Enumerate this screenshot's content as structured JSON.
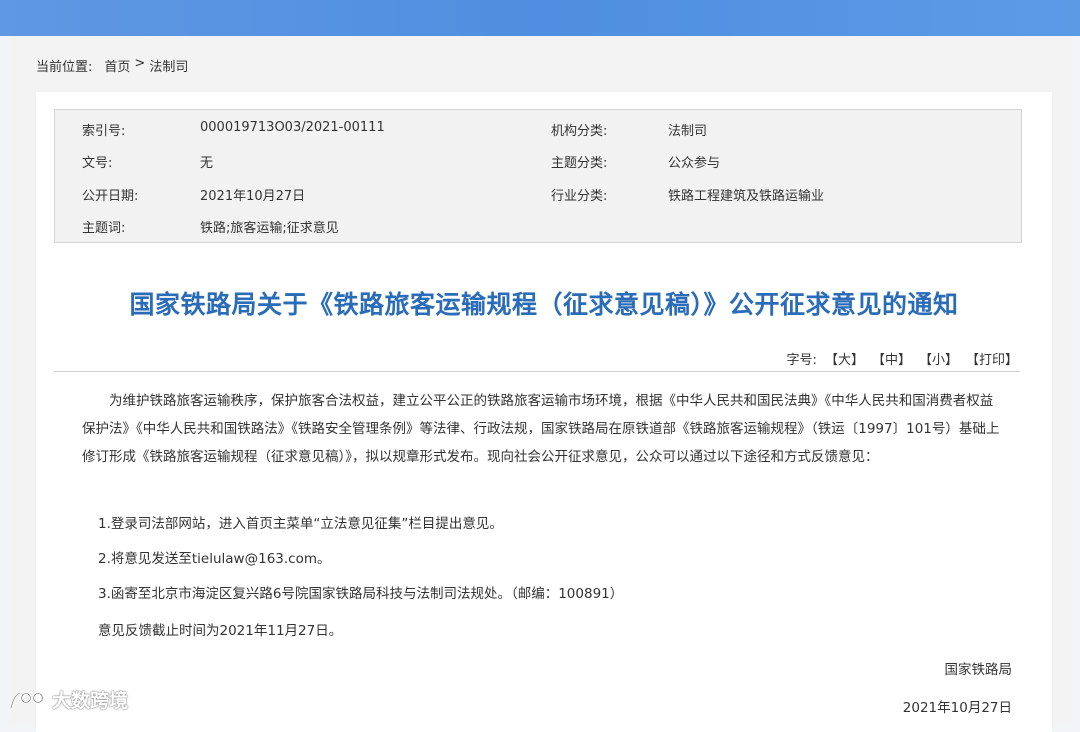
{
  "breadcrumb": {
    "label": "当前位置:",
    "home": "首页",
    "separator": ">",
    "current": "法制司"
  },
  "meta": {
    "index_label": "索引号:",
    "index_value": "000019713O03/2021-00111",
    "org_label": "机构分类:",
    "org_value": "法制司",
    "docno_label": "文号:",
    "docno_value": "无",
    "topic_label": "主题分类:",
    "topic_value": "公众参与",
    "date_label": "公开日期:",
    "date_value": "2021年10月27日",
    "industry_label": "行业分类:",
    "industry_value": "铁路工程建筑及铁路运输业",
    "keywords_label": "主题词:",
    "keywords_value": "铁路;旅客运输;征求意见"
  },
  "article": {
    "title": "国家铁路局关于《铁路旅客运输规程（征求意见稿）》公开征求意见的通知",
    "intro": "为维护铁路旅客运输秩序，保护旅客合法权益，建立公平公正的铁路旅客运输市场环境，根据《中华人民共和国民法典》《中华人民共和国消费者权益保护法》《中华人民共和国铁路法》《铁路安全管理条例》等法律、行政法规，国家铁路局在原铁道部《铁路旅客运输规程》（铁运〔1997〕101号）基础上修订形成《铁路旅客运输规程（征求意见稿）》，拟以规章形式发布。现向社会公开征求意见，公众可以通过以下途径和方式反馈意见：",
    "item1": "1.登录司法部网站，进入首页主菜单“立法意见征集”栏目提出意见。",
    "item2": "2.将意见发送至tielulaw@163.com。",
    "item3": "3.函寄至北京市海淀区复兴路6号院国家铁路局科技与法制司法规处。（邮编：100891）",
    "deadline": "意见反馈截止时间为2021年11月27日。",
    "signer": "国家铁路局",
    "sign_date": "2021年10月27日"
  },
  "font_size": {
    "label": "字号:",
    "large": "【大】",
    "medium": "【中】",
    "small": "【小】",
    "print": "【打印】"
  },
  "watermark": {
    "text": "大数跨境"
  },
  "colors": {
    "banner": "#4f8ee0",
    "title": "#2a6cb7"
  }
}
